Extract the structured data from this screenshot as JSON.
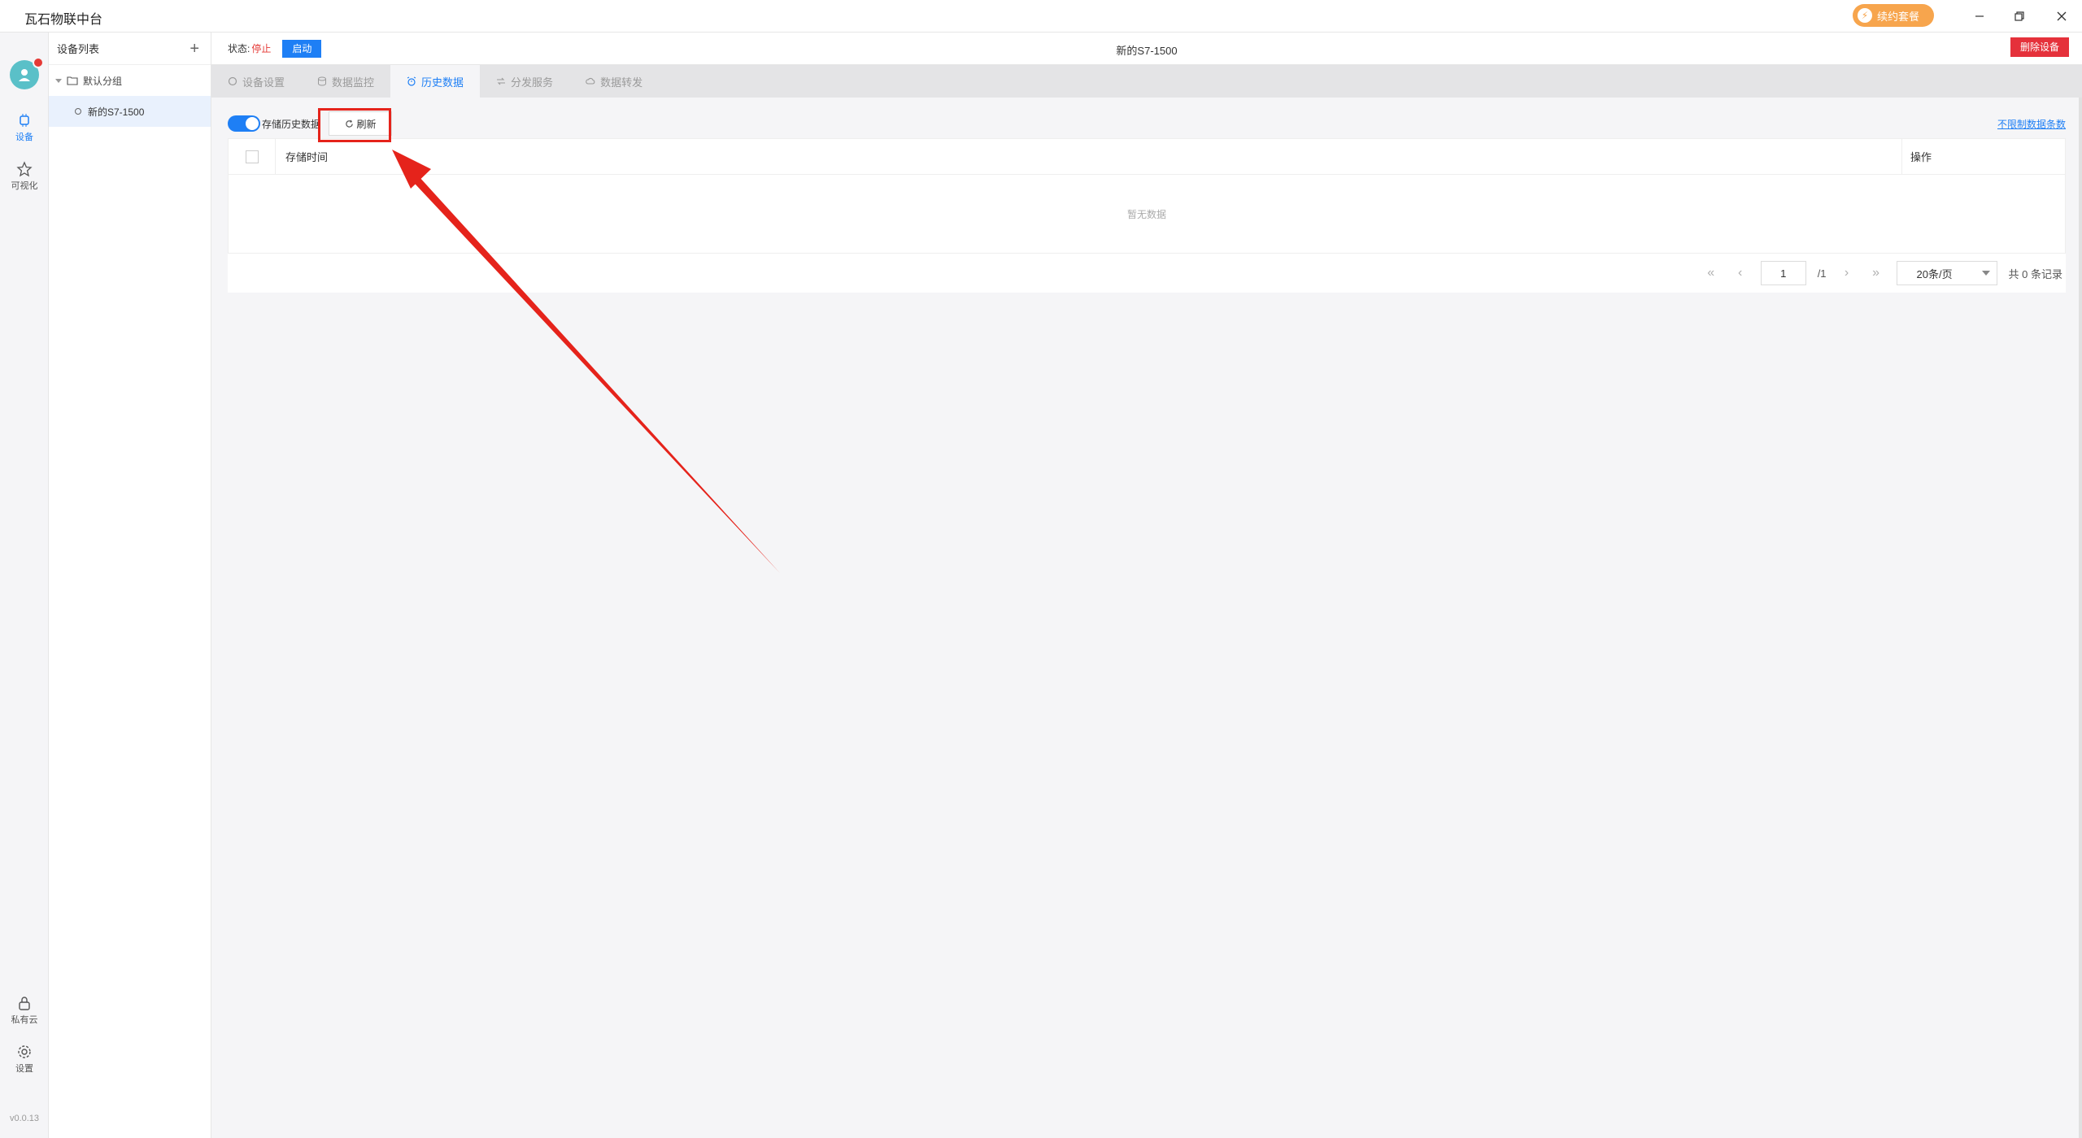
{
  "app": {
    "title": "瓦石物联中台",
    "renew_label": "续约套餐"
  },
  "rail": {
    "items": [
      {
        "label": "设备",
        "icon": "chip-icon",
        "active": true
      },
      {
        "label": "可视化",
        "icon": "star-icon",
        "active": false
      }
    ],
    "bottom_items": [
      {
        "label": "私有云",
        "icon": "lock-icon"
      },
      {
        "label": "设置",
        "icon": "gear-icon"
      }
    ],
    "version": "v0.0.13"
  },
  "device_panel": {
    "title": "设备列表",
    "add_icon": "+",
    "group": "默认分组",
    "device": "新的S7-1500"
  },
  "status_bar": {
    "status_label": "状态:",
    "status_value": "停止",
    "start_label": "启动",
    "device_title": "新的S7-1500",
    "delete_label": "删除设备"
  },
  "tabs": [
    {
      "label": "设备设置",
      "icon": "circle-icon",
      "active": false
    },
    {
      "label": "数据监控",
      "icon": "database-icon",
      "active": false
    },
    {
      "label": "历史数据",
      "icon": "alarm-clock-icon",
      "active": true
    },
    {
      "label": "分发服务",
      "icon": "share-icon",
      "active": false
    },
    {
      "label": "数据转发",
      "icon": "cloud-icon",
      "active": false
    }
  ],
  "toolbar": {
    "store_history_label": "存储历史数据",
    "store_history_on": true,
    "refresh_label": "刷新",
    "unlimited_link": "不限制数据条数"
  },
  "table": {
    "columns": [
      "存储时间",
      "操作"
    ],
    "rows": [],
    "empty_text": "暂无数据"
  },
  "pagination": {
    "current_page": "1",
    "total_pages": "/1",
    "page_size": "20条/页",
    "total_text": "共 0 条记录"
  },
  "colors": {
    "primary": "#1e7ff5",
    "danger": "#e5313b",
    "annotation": "#e5231b",
    "renew": "#f7a54d"
  }
}
